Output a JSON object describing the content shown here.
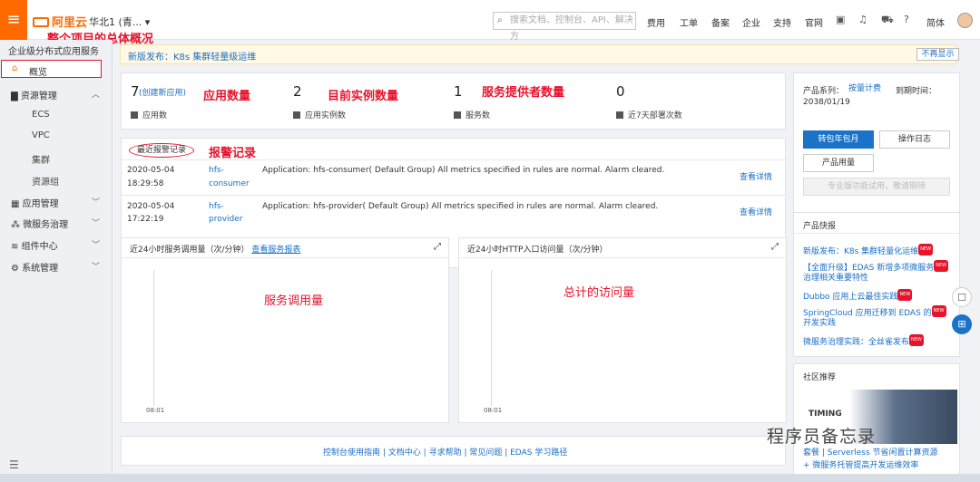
{
  "topbar": {
    "logo": "阿里云",
    "region": "华北1 (青... ▾",
    "search_placeholder": "搜索文档、控制台、API、解决方",
    "nav": [
      "费用",
      "工单",
      "备案",
      "企业",
      "支持",
      "官网"
    ],
    "lang": "简体"
  },
  "annotations": {
    "overview": "整个项目的总体概况",
    "apps": "应用数量",
    "instances": "目前实例数量",
    "providers": "服务提供者数量",
    "alarms": "报警记录",
    "service_calls": "服务调用量",
    "visits": "总计的访问量"
  },
  "sidebar": {
    "title": "企业级分布式应用服务",
    "overview": "概览",
    "resource": "资源管理",
    "resource_sub": [
      "ECS",
      "VPC",
      "集群",
      "资源组"
    ],
    "app": "应用管理",
    "micro": "微服务治理",
    "component": "组件中心",
    "system": "系统管理"
  },
  "banner": {
    "text": "新版发布：K8s 集群轻量级运维",
    "dismiss": "不再显示"
  },
  "stats": [
    {
      "num": "7",
      "link": "(创建新应用)",
      "label": "应用数"
    },
    {
      "num": "2",
      "label": "应用实例数"
    },
    {
      "num": "1",
      "label": "服务数"
    },
    {
      "num": "0",
      "label": "近7天部署次数"
    }
  ],
  "alarms": {
    "title": "最近报警记录",
    "rows": [
      {
        "date": "2020-05-04",
        "time": "18:29:58",
        "app": "hfs-",
        "app2": "consumer",
        "msg": "Application: hfs-consumer( Default Group) All metrics specified in rules are normal. Alarm cleared.",
        "action": "查看详情"
      },
      {
        "date": "2020-05-04",
        "time": "17:22:19",
        "app": "hfs-",
        "app2": "provider",
        "msg": "Application: hfs-provider( Default Group) All metrics specified in rules are normal. Alarm cleared.",
        "action": "查看详情"
      }
    ]
  },
  "charts": {
    "left_title": "近24小时服务调用量（次/分钟）",
    "left_link": "查看服务报表",
    "right_title": "近24小时HTTP入口访问量（次/分钟）",
    "tick": "08:01"
  },
  "footer": {
    "links": [
      "控制台使用指南",
      "文档中心",
      "寻求帮助",
      "常见问题",
      "EDAS 学习路径"
    ]
  },
  "right": {
    "series_label": "产品系列：",
    "series_value": "按量计费",
    "expire_label": "到期时间：",
    "expire_value": "2038/01/19",
    "btn_convert": "转包年包月",
    "btn_log": "操作日志",
    "btn_usage": "产品用量",
    "btn_disabled": "专业版功能试用，敬请期待",
    "news_title": "产品快报",
    "news": [
      "新版发布：K8s 集群轻量化运维",
      "【全面升级】EDAS 新增多项微服务",
      "治理相关重要特性",
      "Dubbo 应用上云最佳实践",
      "SpringCloud 应用迁移到 EDAS 的",
      "开发实践",
      "微服务治理实践：全丝雀发布"
    ],
    "new_badge": "NEW",
    "community_title": "社区推荐",
    "community_img_text": "TIMING",
    "community_link": "+ 微服务托管提高开发运维效率",
    "community_link_top": "套餐 | Serverless 节省闲置计算资源"
  },
  "watermark": "程序员备忘录",
  "colors": {
    "accent": "#ff6a00",
    "link": "#1a6fc7",
    "annotation": "#e8132b",
    "primary_btn": "#1a73c7"
  }
}
